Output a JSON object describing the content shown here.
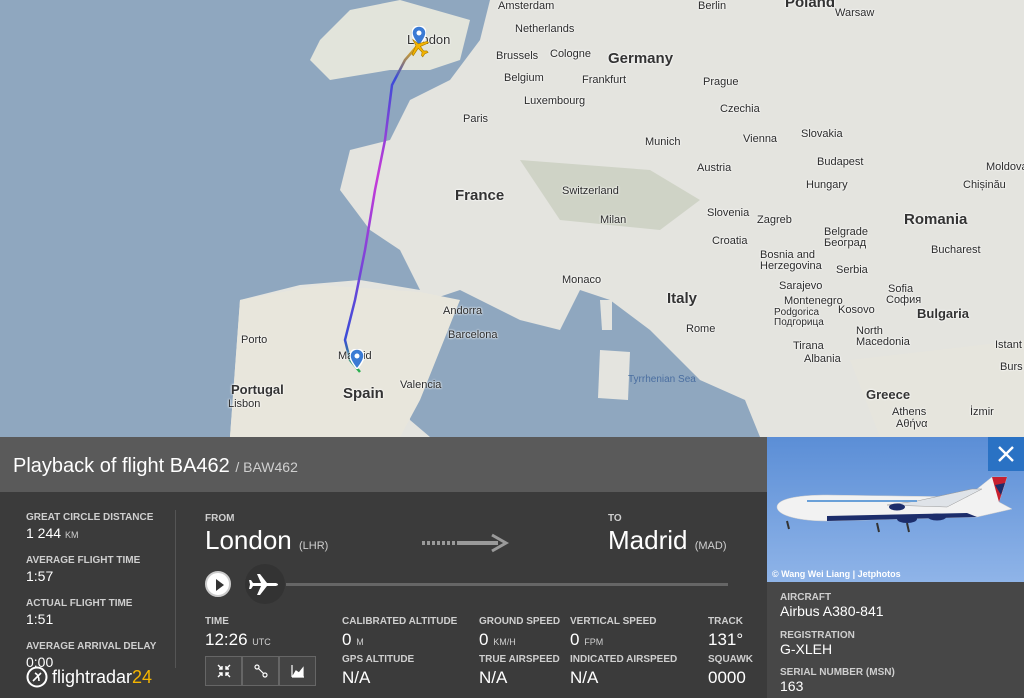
{
  "map": {
    "labels": {
      "amsterdam": "Amsterdam",
      "berlin": "Berlin",
      "poland": "Poland",
      "warsaw": "Warsaw",
      "london": "London",
      "netherlands": "Netherlands",
      "brussels": "Brussels",
      "cologne": "Cologne",
      "belgium": "Belgium",
      "germany": "Germany",
      "frankfurt": "Frankfurt",
      "prague": "Prague",
      "luxembourg": "Luxembourg",
      "czechia": "Czechia",
      "paris": "Paris",
      "slovakia": "Slovakia",
      "munich": "Munich",
      "vienna": "Vienna",
      "budapest": "Budapest",
      "moldova": "Moldova",
      "chisinau": "Chișinău",
      "austria": "Austria",
      "hungary": "Hungary",
      "france": "France",
      "switzerland": "Switzerland",
      "slovenia": "Slovenia",
      "zagreb": "Zagreb",
      "romania": "Romania",
      "milan": "Milan",
      "croatia": "Croatia",
      "belgrade": "Belgrade",
      "belgrade_cyr": "Београд",
      "bucharest": "Bucharest",
      "bosnia": "Bosnia and Herzegovina",
      "serbia": "Serbia",
      "monaco": "Monaco",
      "sarajevo": "Sarajevo",
      "montenegro": "Montenegro",
      "podgorica": "Podgorica",
      "podgorica_cyr": "Подгорица",
      "sofia": "Sofia",
      "sofia_cyr": "София",
      "bulgaria": "Bulgaria",
      "italy": "Italy",
      "kosovo": "Kosovo",
      "andorra": "Andorra",
      "rome": "Rome",
      "north_macedonia": "North Macedonia",
      "porto": "Porto",
      "barcelona": "Barcelona",
      "tirana": "Tirana",
      "albania": "Albania",
      "istanbul": "Istant",
      "madrid": "Madrid",
      "bursa": "Burs",
      "tyrrhenian": "Tyrrhenian Sea",
      "portugal": "Portugal",
      "lisbon": "Lisbon",
      "valencia": "Valencia",
      "spain": "Spain",
      "greece": "Greece",
      "athens": "Athens",
      "athens_gr": "Αθήνα",
      "izmir": "İzmir"
    }
  },
  "panel": {
    "title": "Playback of flight BA462",
    "subtitle": "/ BAW462",
    "stats": [
      {
        "label": "GREAT CIRCLE DISTANCE",
        "value": "1 244",
        "unit": "KM"
      },
      {
        "label": "AVERAGE FLIGHT TIME",
        "value": "1:57",
        "unit": ""
      },
      {
        "label": "ACTUAL FLIGHT TIME",
        "value": "1:51",
        "unit": ""
      },
      {
        "label": "AVERAGE ARRIVAL DELAY",
        "value": "0:00",
        "unit": ""
      }
    ],
    "logo_text": "flightradar",
    "logo_num": "24",
    "from_label": "FROM",
    "from_city": "London",
    "from_code": "(LHR)",
    "to_label": "TO",
    "to_city": "Madrid",
    "to_code": "(MAD)",
    "playback_progress": 0.0,
    "fields": {
      "time_label": "TIME",
      "time_value": "12:26",
      "time_unit": "UTC",
      "cal_alt_label": "CALIBRATED ALTITUDE",
      "cal_alt_value": "0",
      "cal_alt_unit": "M",
      "gps_alt_label": "GPS ALTITUDE",
      "gps_alt_value": "N/A",
      "ground_speed_label": "GROUND SPEED",
      "ground_speed_value": "0",
      "ground_speed_unit": "KM/H",
      "true_airspeed_label": "TRUE AIRSPEED",
      "true_airspeed_value": "N/A",
      "vert_speed_label": "VERTICAL SPEED",
      "vert_speed_value": "0",
      "vert_speed_unit": "FPM",
      "ind_airspeed_label": "INDICATED AIRSPEED",
      "ind_airspeed_value": "N/A",
      "track_label": "TRACK",
      "track_value": "131°",
      "squawk_label": "SQUAWK",
      "squawk_value": "0000"
    }
  },
  "aircraft": {
    "photo_credit": "© Wang Wei Liang | Jetphotos",
    "aircraft_label": "AIRCRAFT",
    "aircraft_value": "Airbus A380-841",
    "registration_label": "REGISTRATION",
    "registration_value": "G-XLEH",
    "serial_label": "SERIAL NUMBER (MSN)",
    "serial_value": "163"
  },
  "colors": {
    "accent": "#2a72c4",
    "logo_accent": "#f4b400",
    "route_start": "#3a4cd8",
    "route_end": "#c83ad8"
  }
}
